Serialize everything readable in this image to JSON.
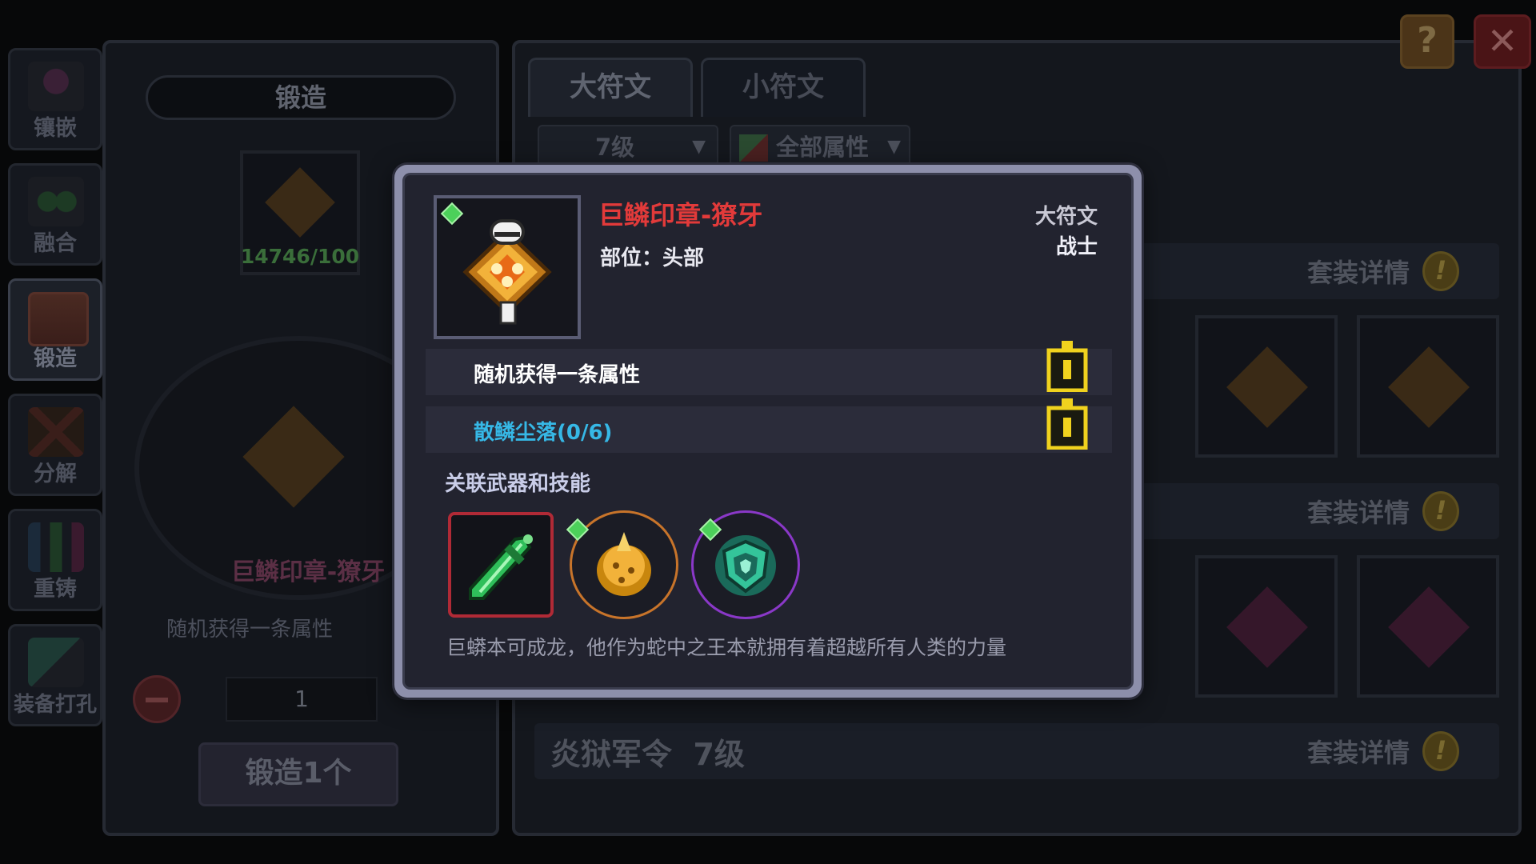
{
  "left_rail": [
    {
      "label": "镶嵌",
      "icon": "inlay-icon"
    },
    {
      "label": "融合",
      "icon": "fusion-icon"
    },
    {
      "label": "锻造",
      "icon": "forge-icon",
      "active": true
    },
    {
      "label": "分解",
      "icon": "decompose-icon"
    },
    {
      "label": "重铸",
      "icon": "recast-icon"
    },
    {
      "label": "装备打孔",
      "icon": "socket-icon"
    }
  ],
  "forge": {
    "title": "锻造",
    "material_count": "14746/100",
    "item_name": "巨鳞印章-獠牙",
    "random_attr": "随机获得一条属性",
    "quantity": "1",
    "forge_button": "锻造1个"
  },
  "rune_tabs": {
    "major": "大符文",
    "minor": "小符文"
  },
  "filters": {
    "level": "7级",
    "attribute": "全部属性"
  },
  "sets": [
    {
      "detail_label": "套装详情"
    },
    {
      "detail_label": "套装详情"
    },
    {
      "title": "炎狱军令",
      "level": "7级",
      "detail_label": "套装详情"
    }
  ],
  "top_buttons": {
    "help": "?",
    "close": "✕"
  },
  "popup": {
    "item_name": "巨鳞印章-獠牙",
    "slot_text": "部位：头部",
    "tier": "大符文",
    "class": "战士",
    "attributes": [
      {
        "text": "随机获得一条属性",
        "color": "#ffffff",
        "locked": true
      },
      {
        "text": "散鳞尘落(0/6)",
        "color": "#36b8e6",
        "locked": true
      }
    ],
    "related_label": "关联武器和技能",
    "related": [
      {
        "icon": "jade-sword-icon",
        "frame": "#b02a36"
      },
      {
        "icon": "golden-egg-icon",
        "frame": "#c8742a"
      },
      {
        "icon": "jade-shield-icon",
        "frame": "#8a38c8"
      }
    ],
    "description": "巨蟒本可成龙，他作为蛇中之王本就拥有着超越所有人类的力量"
  }
}
